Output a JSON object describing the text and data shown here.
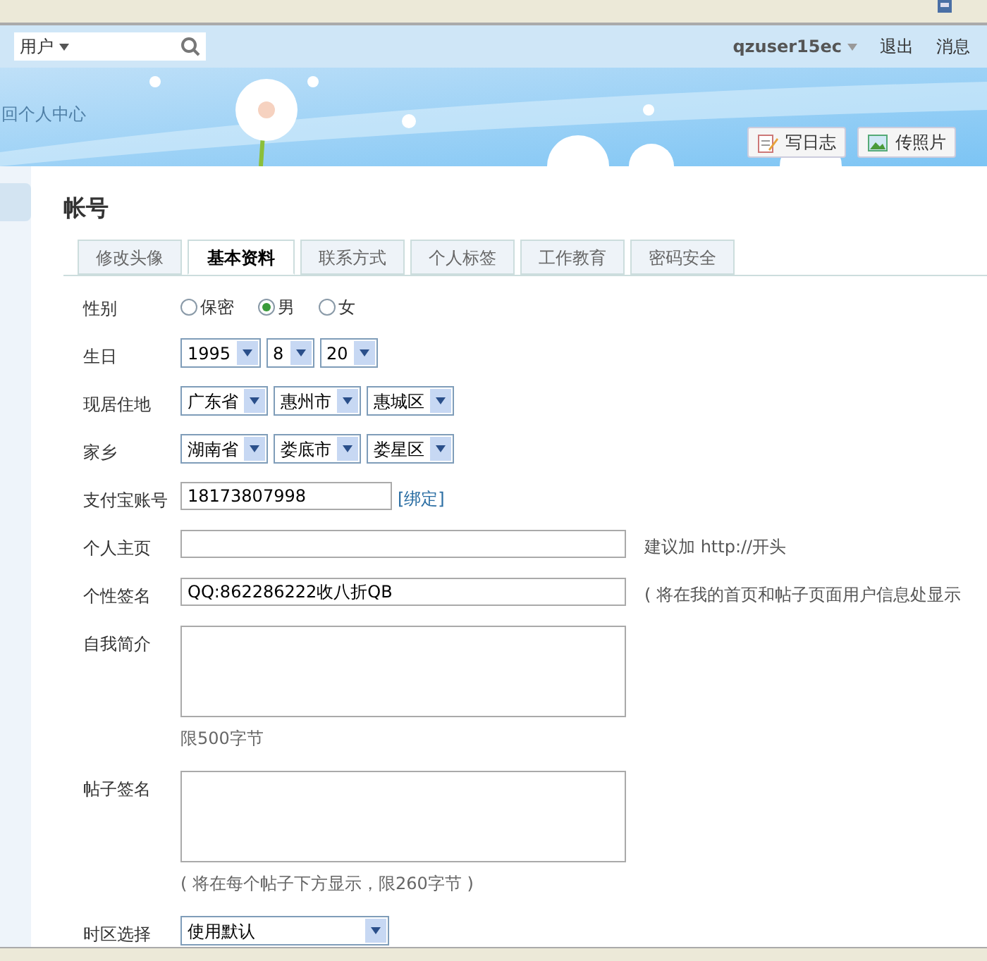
{
  "header": {
    "search_scope": "用户",
    "username": "qzuser15ec",
    "links": [
      "退出",
      "消息"
    ]
  },
  "banner": {
    "back_link": "回个人中心",
    "buttons": [
      {
        "label": "写日志",
        "kind": "blog"
      },
      {
        "label": "传照片"
      }
    ]
  },
  "page_title": "帐号",
  "tabs": [
    {
      "label": "修改头像",
      "selected": false
    },
    {
      "label": "基本资料",
      "selected": true
    },
    {
      "label": "联系方式",
      "selected": false
    },
    {
      "label": "个人标签",
      "selected": false
    },
    {
      "label": "工作教育",
      "selected": false
    },
    {
      "label": "密码安全",
      "selected": false
    }
  ],
  "form": [
    {
      "kind": "radio",
      "label": "性别",
      "options": [
        {
          "label": "保密",
          "selected": false
        },
        {
          "label": "男",
          "selected": true
        },
        {
          "label": "女",
          "selected": false
        }
      ]
    },
    {
      "kind": "selects",
      "label": "生日",
      "values": [
        "1995",
        "8",
        "20"
      ]
    },
    {
      "kind": "selects",
      "label": "现居住地",
      "values": [
        "广东省",
        "惠州市",
        "惠城区"
      ]
    },
    {
      "kind": "selects",
      "label": "家乡",
      "values": [
        "湖南省",
        "娄底市",
        "娄星区"
      ]
    },
    {
      "kind": "text",
      "label": "支付宝账号",
      "value": "18173807998",
      "link": "[绑定]"
    },
    {
      "kind": "text",
      "label": "个人主页",
      "note": "建议加 http://开头"
    },
    {
      "kind": "text",
      "label": "个性签名",
      "value": "QQ:862286222收八折QB",
      "note": "( 将在我的首页和帖子页面用户信息处显示"
    },
    {
      "kind": "textarea",
      "label": "自我简介",
      "hint": "限500字节"
    },
    {
      "kind": "textarea",
      "label": "帖子签名",
      "hint": "( 将在每个帖子下方显示，限260字节 )"
    },
    {
      "kind": "wideselect",
      "label": "时区选择",
      "value": "使用默认"
    }
  ]
}
